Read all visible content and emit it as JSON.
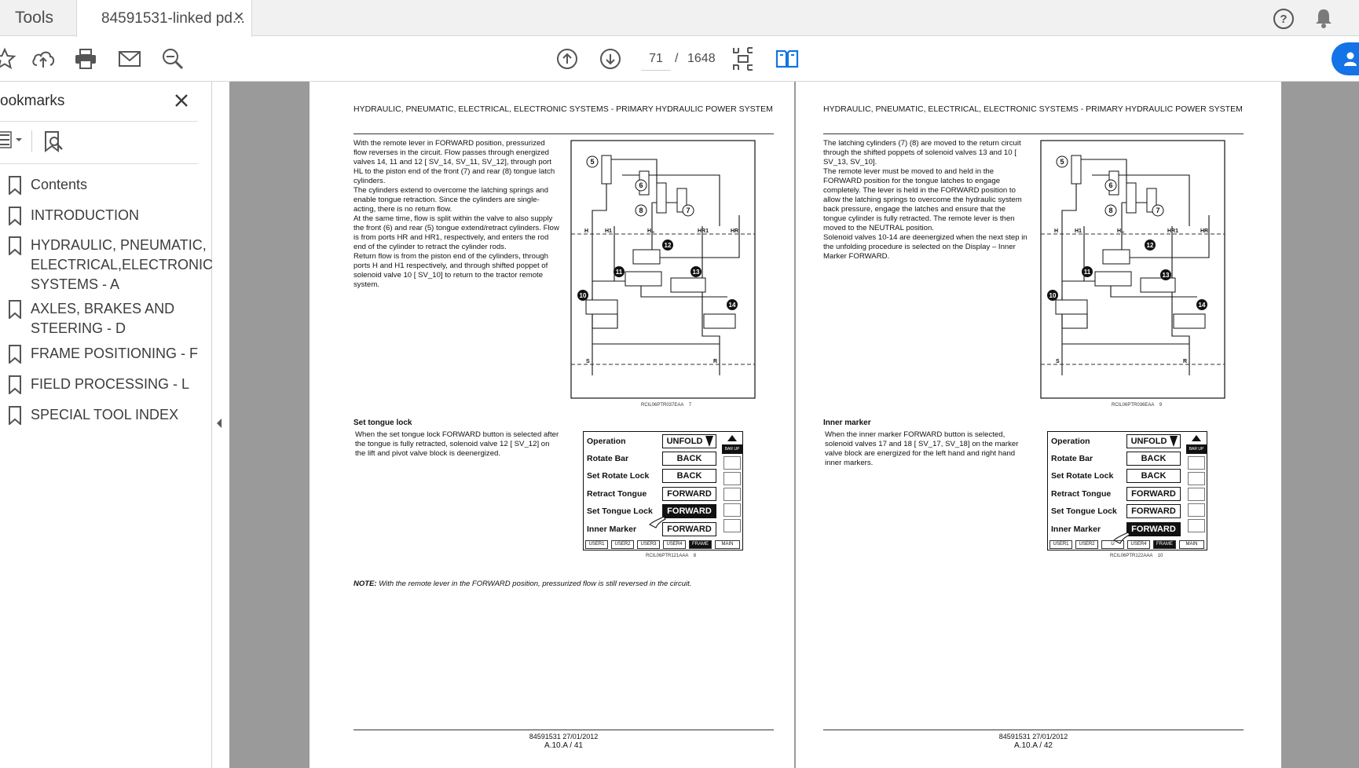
{
  "tabs": {
    "tools_label": "Tools",
    "document_label": "84591531-linked pd...",
    "close_symbol": "✕"
  },
  "toolbar": {
    "page_current": "71",
    "page_separator": "/",
    "page_total": "1648"
  },
  "sidebar": {
    "title": "ookmarks",
    "items": [
      {
        "label": "Contents"
      },
      {
        "label": "INTRODUCTION"
      },
      {
        "label": "HYDRAULIC, PNEUMATIC, ELECTRICAL,ELECTRONIC SYSTEMS - A"
      },
      {
        "label": "AXLES, BRAKES AND STEERING - D"
      },
      {
        "label": "FRAME POSITIONING - F"
      },
      {
        "label": "FIELD PROCESSING - L"
      },
      {
        "label": "SPECIAL TOOL INDEX"
      }
    ]
  },
  "pages": [
    {
      "header": "HYDRAULIC, PNEUMATIC, ELECTRICAL, ELECTRONIC SYSTEMS - PRIMARY HYDRAULIC POWER SYSTEM",
      "paragraphs": [
        "With the remote lever in FORWARD position, pressurized flow reverses in the circuit.  Flow passes through energized valves 14, 11 and 12 [ SV_14, SV_11, SV_12], through port HL to the piston end of the front (7) and rear (8) tongue latch cylinders.",
        "The cylinders extend to overcome the latching springs and enable tongue retraction.  Since the cylinders are single-acting, there is no return flow.",
        "At the same time, flow is split within the valve to also supply the front (6) and rear (5) tongue extend/retract cylinders.  Flow is from ports HR and HR1, respectively, and enters the rod end of the cylinder to retract the cylinder rods.",
        "Return flow is from the piston end of the cylinders, through ports H and H1 respectively, and through shifted poppet of solenoid valve 10 [ SV_10] to return to the tractor remote system."
      ],
      "diagram_caption": "RCIL06PTR037EAA",
      "diagram_number": "7",
      "section_title": "Set tongue lock",
      "section_text": "When the set tongue lock FORWARD button is selected after the tongue is fully retracted, solenoid valve 12 [ SV_12] on the lift and pivot valve block is deenergized.",
      "panel_caption": "RCIL06PTR121AAA",
      "panel_number": "8",
      "note_label": "NOTE:",
      "note_text": "With the remote lever in the FORWARD position, pressurized flow is still reversed in the circuit.",
      "footer_line1": "84591531 27/01/2012",
      "footer_line2": "A.10.A / 41"
    },
    {
      "header": "HYDRAULIC, PNEUMATIC, ELECTRICAL, ELECTRONIC SYSTEMS - PRIMARY HYDRAULIC POWER SYSTEM",
      "paragraphs": [
        "The latching cylinders (7) (8) are moved to the return circuit through the shifted poppets of solenoid valves 13 and 10 [ SV_13, SV_10].",
        "The remote lever must be moved to and held in the FORWARD position for the tongue latches to engage completely.  The lever is held in the FORWARD position to allow the latching springs to overcome the hydraulic system back pressure, engage the latches and ensure that the tongue cylinder is fully retracted.  The remote lever is then moved to the NEUTRAL position.",
        "Solenoid valves 10-14 are deenergized when the next step in the unfolding procedure is selected on the Display – Inner Marker FORWARD."
      ],
      "diagram_caption": "RCIL06PTR036EAA",
      "diagram_number": "9",
      "section_title": "Inner marker",
      "section_text": "When the inner marker FORWARD button is selected, solenoid valves 17 and 18 [ SV_17, SV_18] on the marker valve block are energized for the left hand and right hand inner markers.",
      "panel_caption": "RCIL06PTR122AAA",
      "panel_number": "10",
      "footer_line1": "84591531 27/01/2012",
      "footer_line2": "A.10.A / 42"
    }
  ],
  "diagram_labels": {
    "callouts": [
      "5",
      "6",
      "8",
      "7",
      "12",
      "11",
      "13",
      "10",
      "14"
    ],
    "ports": [
      "H",
      "H1",
      "HL",
      "HR1",
      "HR",
      "S",
      "R"
    ]
  },
  "display_panels": [
    {
      "rows": [
        {
          "label": "Operation",
          "value": "UNFOLD",
          "selected": false
        },
        {
          "label": "Rotate Bar",
          "value": "BACK",
          "selected": false
        },
        {
          "label": "Set Rotate Lock",
          "value": "BACK",
          "selected": false
        },
        {
          "label": "Retract Tongue",
          "value": "FORWARD",
          "selected": false
        },
        {
          "label": "Set Tongue Lock",
          "value": "FORWARD",
          "selected": true
        },
        {
          "label": "Inner Marker",
          "value": "FORWARD",
          "selected": false
        }
      ],
      "scroll_label": "BAR UP",
      "bottom_tabs": [
        {
          "label": "USER1",
          "selected": false
        },
        {
          "label": "USER2",
          "selected": false
        },
        {
          "label": "USER3",
          "selected": false
        },
        {
          "label": "USER4",
          "selected": false
        },
        {
          "label": "FRAME",
          "selected": true
        },
        {
          "label": "MAIN",
          "selected": false
        }
      ]
    },
    {
      "rows": [
        {
          "label": "Operation",
          "value": "UNFOLD",
          "selected": false
        },
        {
          "label": "Rotate Bar",
          "value": "BACK",
          "selected": false
        },
        {
          "label": "Set Rotate Lock",
          "value": "BACK",
          "selected": false
        },
        {
          "label": "Retract Tongue",
          "value": "FORWARD",
          "selected": false
        },
        {
          "label": "Set Tongue Lock",
          "value": "FORWARD",
          "selected": false
        },
        {
          "label": "Inner Marker",
          "value": "FORWARD",
          "selected": true
        }
      ],
      "scroll_label": "BAR UP",
      "bottom_tabs": [
        {
          "label": "USER1",
          "selected": false
        },
        {
          "label": "USER2",
          "selected": false
        },
        {
          "label": "U",
          "selected": false
        },
        {
          "label": "USER4",
          "selected": false
        },
        {
          "label": "FRAME",
          "selected": true
        },
        {
          "label": "MAIN",
          "selected": false
        }
      ]
    }
  ],
  "colors": {
    "accent": "#1473e6",
    "viewer_background": "#9a9a9a",
    "tab_bar": "#f1f1f1"
  },
  "icons": [
    "star-icon",
    "upload-icon",
    "print-icon",
    "email-icon",
    "zoom-icon",
    "page-up-icon",
    "page-down-icon",
    "fit-page-icon",
    "two-page-icon",
    "help-icon",
    "bell-icon",
    "bookmark-options-icon",
    "bookmark-search-icon",
    "bookmark-icon",
    "collapse-panel-icon"
  ]
}
